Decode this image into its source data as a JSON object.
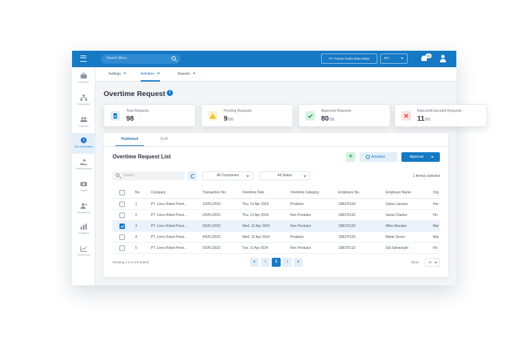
{
  "topbar": {
    "search_placeholder": "Search Menu",
    "company": "PT. Krama Yudha Ratu Motor",
    "language": "EN",
    "notification_count": "99"
  },
  "sidebar": {
    "items": [
      {
        "label": "Workforce",
        "icon": "briefcase-icon"
      },
      {
        "label": "Organization",
        "icon": "org-chart-icon"
      },
      {
        "label": "Employee",
        "icon": "people-icon"
      },
      {
        "label": "Time & Attendance",
        "icon": "clock-icon",
        "active": true
      },
      {
        "label": "Reimbursement",
        "icon": "hand-coin-icon"
      },
      {
        "label": "Payroll",
        "icon": "money-icon"
      },
      {
        "label": "Recruitment",
        "icon": "user-add-icon"
      },
      {
        "label": "Evaluation",
        "icon": "bar-chart-icon"
      },
      {
        "label": "Performance",
        "icon": "line-chart-icon"
      }
    ]
  },
  "nav_tabs": [
    "Settings",
    "Activities",
    "Reports"
  ],
  "page": {
    "title": "Overtime Request"
  },
  "cards": [
    {
      "label": "Total Requests",
      "value": "98",
      "suffix": "",
      "icon": "document-icon",
      "color": "#1579c4"
    },
    {
      "label": "Pending Requests",
      "value": "9",
      "suffix": "/98",
      "icon": "warning-icon",
      "color": "#f2b705"
    },
    {
      "label": "Approved Requests",
      "value": "80",
      "suffix": "/98",
      "icon": "check-icon",
      "color": "#22a559"
    },
    {
      "label": "Rejected/Canceled Requests",
      "value": "11",
      "suffix": "/98",
      "icon": "close-icon",
      "color": "#e04545"
    }
  ],
  "panel": {
    "tabs": [
      "Published",
      "Draft"
    ],
    "list_title": "Overtime Request List",
    "add_label": "+",
    "actualize_label": "Actualize",
    "approval_label": "Approval",
    "search_placeholder": "Search",
    "filter_company": "All Companies",
    "filter_status": "All Status",
    "selected_text": "1 item(s) selected"
  },
  "table": {
    "columns": [
      "No",
      "Company",
      "Transaction No.",
      "Overtime Date",
      "Overtime Category",
      "Employee No.",
      "Employee Name",
      "Org"
    ],
    "rows": [
      {
        "checked": false,
        "cells": [
          "1",
          "PT. Linov Roket Prest...",
          "1/SPL/2023",
          "Thu, 13 Apr 2024",
          "Produksi",
          "198376164",
          "Zahra Larsson",
          "Hur"
        ]
      },
      {
        "checked": false,
        "cells": [
          "2",
          "PT. Linov Roket Prest...",
          "2/SPL/2023",
          "Thu, 13 Apr 2024",
          "Non Produksi",
          "198376132",
          "Sania Charles",
          "Fin"
        ]
      },
      {
        "checked": true,
        "cells": [
          "3",
          "PT. Linov Roket Prest...",
          "3/SPL/2023",
          "Wed, 12 Apr 2024",
          "Non Produksi",
          "198376132",
          "Miles Morales",
          "Mar"
        ]
      },
      {
        "checked": false,
        "cells": [
          "4",
          "PT. Linov Roket Prest...",
          "4/SPL/2023",
          "Wed, 12 Apr 2024",
          "Produksi",
          "198376132",
          "Wade Green",
          "Mar"
        ]
      },
      {
        "checked": false,
        "cells": [
          "5",
          "PT. Linov Roket Prest...",
          "5/SPL/2023",
          "Tue, 11 Apr 2024",
          "Non Produksi",
          "198376132",
          "Siti Zahrasiyah",
          "Fin"
        ]
      }
    ]
  },
  "footer": {
    "showing": "Showing 1 to 5 of 5 entries",
    "first": "«",
    "prev": "‹",
    "current_page": "1",
    "next": "›",
    "last": "»",
    "show_label": "Show",
    "page_size": "10"
  }
}
